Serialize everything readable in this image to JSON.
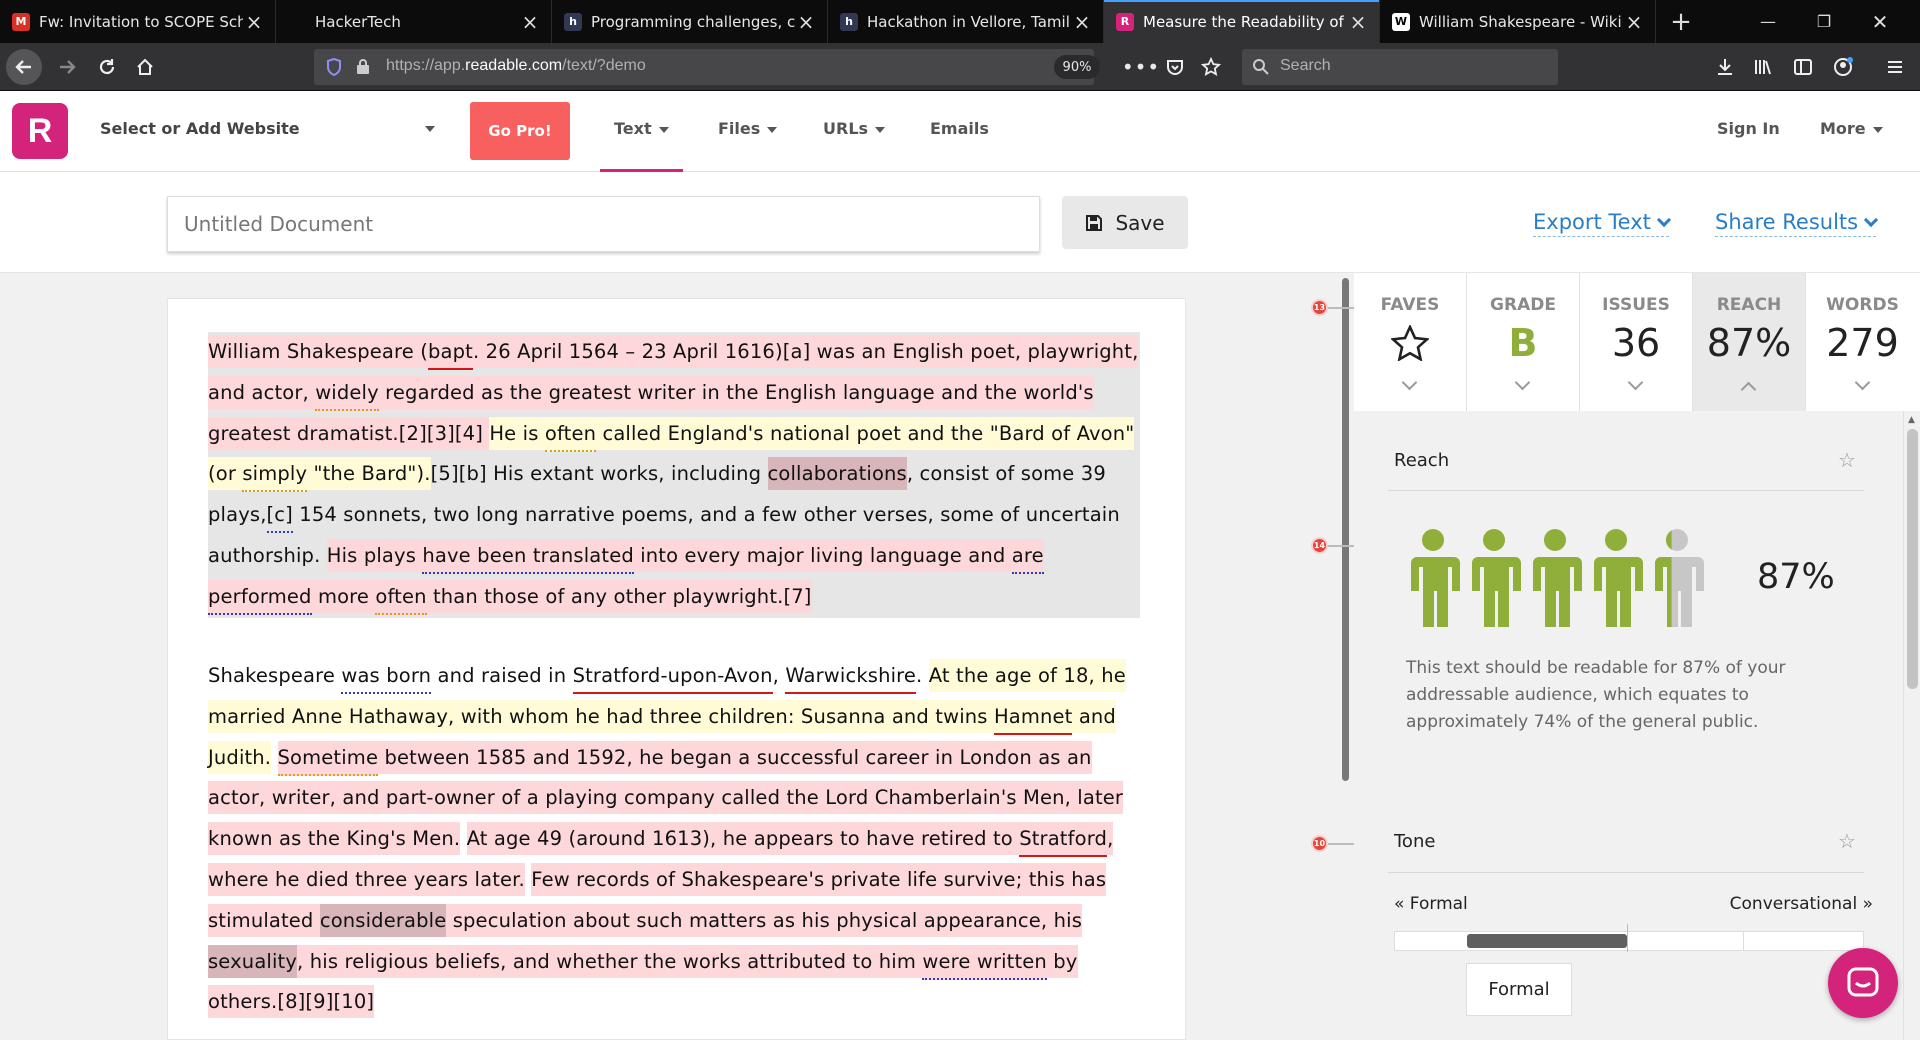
{
  "browser": {
    "tabs": [
      {
        "title": "Fw: Invitation to SCOPE School",
        "favicon": "gmail-icon",
        "color": "#d93025"
      },
      {
        "title": "HackerTech",
        "favicon": "blank-icon",
        "color": "#0c0c0d"
      },
      {
        "title": "Programming challenges, codi",
        "favicon": "hackerearth-icon",
        "color": "#323754"
      },
      {
        "title": "Hackathon in Vellore, Tamil Na",
        "favicon": "hackerearth-icon",
        "color": "#323754"
      },
      {
        "title": "Measure the Readability of Te",
        "favicon": "readable-icon",
        "color": "#d4237a"
      },
      {
        "title": "William Shakespeare - Wikipe",
        "favicon": "wikipedia-icon",
        "color": "#ffffff"
      }
    ],
    "url_prefix": "https://app.",
    "url_domain": "readable.com",
    "url_path": "/text/?demo",
    "zoom": "90%",
    "search_placeholder": "Search"
  },
  "header": {
    "logo": "R",
    "site_select": "Select or Add Website",
    "go_pro": "Go Pro!",
    "nav": {
      "text": "Text",
      "files": "Files",
      "urls": "URLs",
      "emails": "Emails"
    },
    "sign_in": "Sign In",
    "more": "More"
  },
  "doc_header": {
    "title_placeholder": "Untitled Document",
    "save": "Save",
    "export": "Export Text",
    "share": "Share Results"
  },
  "stats": {
    "faves_label": "FAVES",
    "grade_label": "GRADE",
    "grade": "B",
    "issues_label": "ISSUES",
    "issues": "36",
    "reach_label": "REACH",
    "reach": "87%",
    "words_label": "WORDS",
    "words": "279"
  },
  "reach": {
    "title": "Reach",
    "percent": "87%",
    "description": "This text should be readable for 87% of your addressable audience, which equates to approximately 74% of the general public.",
    "person_fill": [
      1,
      1,
      1,
      1,
      0.4
    ],
    "fill_color": "#8fae3a",
    "empty_color": "#c7c7c7"
  },
  "tone": {
    "title": "Tone",
    "left": "« Formal",
    "right": "Conversational »",
    "value": "Formal"
  },
  "markers": [
    "13",
    "14",
    "10"
  ],
  "paragraph1": [
    {
      "t": "William Shakespeare ",
      "c": "pk"
    },
    {
      "t": "(",
      "c": "pk"
    },
    {
      "t": "bapt",
      "c": "pk ur"
    },
    {
      "t": ". ",
      "c": "pk"
    },
    {
      "t": "26 April 1564 – 23 April 1616)[a] was an English poet, playwright, and actor, ",
      "c": "pk"
    },
    {
      "t": "widely",
      "c": "pk uo"
    },
    {
      "t": " regarded as the greatest writer in the English language and the world's greatest dramatist.[2][3][4] ",
      "c": "pk"
    },
    {
      "t": "He is ",
      "c": "yl"
    },
    {
      "t": "often",
      "c": "yl uo"
    },
    {
      "t": " called England's national poet and the \"Bard of Avon\" (or ",
      "c": "yl"
    },
    {
      "t": "simply",
      "c": "yl uo"
    },
    {
      "t": " \"the Bard\").",
      "c": "yl"
    },
    {
      "t": "[5][b] His extant works, including ",
      "c": ""
    },
    {
      "t": "collaborations",
      "c": "gr"
    },
    {
      "t": ", consist of some 39 plays,",
      "c": ""
    },
    {
      "t": "[c]",
      "c": "ub"
    },
    {
      "t": " 154 sonnets, two long narrative poems, and a few other verses, some of uncertain authorship. ",
      "c": ""
    },
    {
      "t": "His plays ",
      "c": "pk"
    },
    {
      "t": "have been translated",
      "c": "pk ub"
    },
    {
      "t": " into every major living language and ",
      "c": "pk"
    },
    {
      "t": "are",
      "c": "pk ub"
    },
    {
      "t": " ",
      "c": "pk"
    },
    {
      "t": "performed",
      "c": "pk ub"
    },
    {
      "t": " more ",
      "c": "pk"
    },
    {
      "t": "often",
      "c": "pk uo"
    },
    {
      "t": " than those of any other playwright.[7]",
      "c": "pk"
    }
  ],
  "paragraph2": [
    {
      "t": "Shakespeare ",
      "c": ""
    },
    {
      "t": "was born",
      "c": "ub"
    },
    {
      "t": " and raised in ",
      "c": ""
    },
    {
      "t": "Stratford-upon-Avon",
      "c": "ur"
    },
    {
      "t": ", ",
      "c": ""
    },
    {
      "t": "Warwickshire",
      "c": "ur"
    },
    {
      "t": ". ",
      "c": ""
    },
    {
      "t": "At the age of 18, he married Anne Hathaway, with whom he had three children: Susanna and twins ",
      "c": "yl"
    },
    {
      "t": "Hamnet",
      "c": "yl ur"
    },
    {
      "t": " and Judith.",
      "c": "yl"
    },
    {
      "t": " ",
      "c": ""
    },
    {
      "t": "Sometime",
      "c": "pk uo"
    },
    {
      "t": " between 1585 and 1592, he began a successful career in London as an actor, writer, and part-owner of a playing company called the Lord Chamberlain's Men, later known as the King's Men.",
      "c": "pk"
    },
    {
      "t": " ",
      "c": ""
    },
    {
      "t": "At age 49 (around 1613), he appears to have retired to ",
      "c": "pk"
    },
    {
      "t": "Stratford",
      "c": "pk ur"
    },
    {
      "t": ", where he died three years later.",
      "c": "pk"
    },
    {
      "t": " ",
      "c": ""
    },
    {
      "t": "Few records of Shakespeare's private life survive; this has stimulated ",
      "c": "pk"
    },
    {
      "t": "considerable",
      "c": "gr"
    },
    {
      "t": " speculation about such matters as his physical appearance, his ",
      "c": "pk"
    },
    {
      "t": "sexuality",
      "c": "gr"
    },
    {
      "t": ", his religious beliefs, and whether the works attributed to him ",
      "c": "pk"
    },
    {
      "t": "were written",
      "c": "pk ub"
    },
    {
      "t": " by others.[8][9][10]",
      "c": "pk"
    }
  ]
}
